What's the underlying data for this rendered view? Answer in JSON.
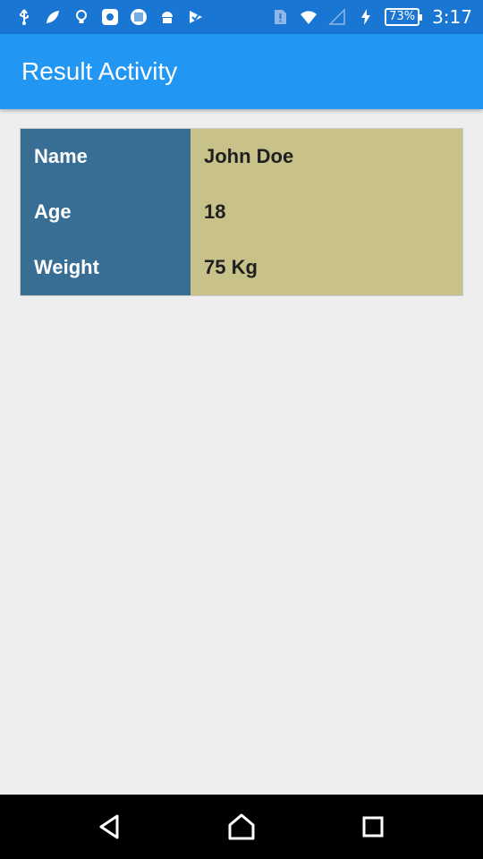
{
  "status_bar": {
    "time": "3:17",
    "battery_percent": "73%",
    "icons": [
      "usb-icon",
      "leaf-icon",
      "lightbulb-icon",
      "app-icon",
      "barcode-icon",
      "android-icon",
      "check-icon",
      "sim-alert-icon",
      "wifi-icon",
      "signal-icon",
      "charging-icon",
      "battery-icon"
    ]
  },
  "app_bar": {
    "title": "Result Activity"
  },
  "result": {
    "rows": [
      {
        "label": "Name",
        "value": "John Doe"
      },
      {
        "label": "Age",
        "value": "18"
      },
      {
        "label": "Weight",
        "value": "75 Kg"
      }
    ]
  },
  "nav_bar": {
    "buttons": [
      "back-icon",
      "home-icon",
      "recents-icon"
    ]
  },
  "colors": {
    "status_bar": "#1976d2",
    "app_bar": "#2196f3",
    "label_column": "#386e94",
    "value_column": "#c9c18a",
    "background": "#eeeeee"
  }
}
